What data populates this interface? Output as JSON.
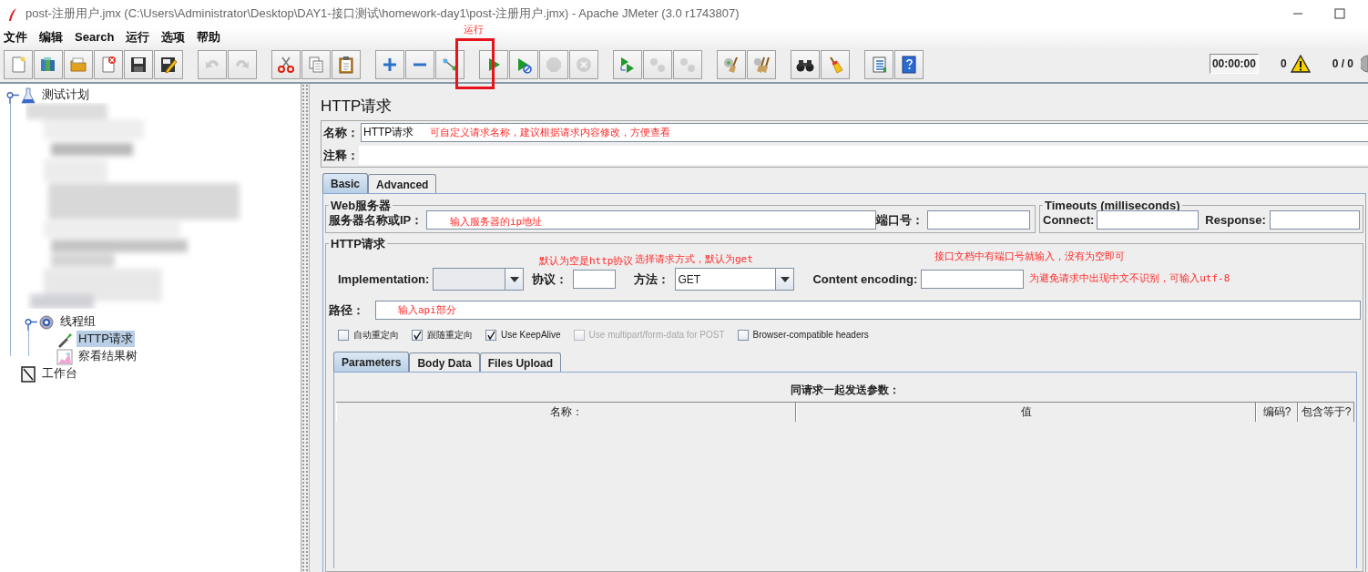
{
  "window": {
    "title": "post-注册用户.jmx (C:\\Users\\Administrator\\Desktop\\DAY1-接口测试\\homework-day1\\post-注册用户.jmx) - Apache JMeter (3.0 r1743807)"
  },
  "menu": [
    "文件",
    "编辑",
    "Search",
    "运行",
    "选项",
    "帮助"
  ],
  "toolbar": {
    "groups": [
      [
        {
          "disabled": false
        },
        {
          "disabled": false
        },
        {
          "disabled": false
        },
        {
          "disabled": false
        },
        {
          "disabled": false
        },
        {
          "disabled": false
        }
      ],
      [
        {
          "disabled": true
        },
        {
          "disabled": true
        }
      ],
      [
        {
          "disabled": false
        },
        {
          "disabled": false
        },
        {
          "disabled": false
        }
      ],
      [
        {
          "disabled": false
        },
        {
          "disabled": false
        },
        {
          "disabled": false
        }
      ],
      [
        {
          "disabled": false
        },
        {
          "disabled": false
        },
        {
          "disabled": true
        },
        {
          "disabled": true
        }
      ],
      [
        {
          "disabled": false
        },
        {
          "disabled": true
        },
        {
          "disabled": true
        }
      ],
      [
        {
          "disabled": false
        },
        {
          "disabled": false
        }
      ],
      [
        {
          "disabled": false
        },
        {
          "disabled": false
        }
      ],
      [
        {
          "disabled": false
        },
        {
          "disabled": false
        }
      ]
    ],
    "timer": "00:00:00",
    "warnings": "0",
    "threads": "0 / 0"
  },
  "tree": [
    {
      "kind": "test_plan",
      "label": "测试计划",
      "selected": false,
      "blurred_children": true,
      "children": [
        {
          "kind": "thread_group",
          "label": "线程组",
          "selected": false,
          "children": [
            {
              "kind": "sampler",
              "label": "HTTP请求",
              "selected": true
            },
            {
              "kind": "listener",
              "label": "察看结果树",
              "selected": false
            }
          ]
        }
      ]
    },
    {
      "kind": "workbench",
      "label": "工作台",
      "selected": false
    }
  ],
  "panel": {
    "title": "HTTP请求",
    "name_label": "名称：",
    "name_value": "HTTP请求",
    "comment_label": "注释：",
    "tabs": [
      {
        "label": "Basic",
        "selected": true
      },
      {
        "label": "Advanced",
        "selected": false
      }
    ],
    "web_server": {
      "legend": "Web服务器",
      "server_label": "服务器名称或IP：",
      "port_label": "端口号："
    },
    "timeouts": {
      "legend": "Timeouts (milliseconds)",
      "connect_label": "Connect:",
      "response_label": "Response:"
    },
    "http_request": {
      "legend": "HTTP请求",
      "implementation_label": "Implementation:",
      "protocol_label": "协议：",
      "method_label": "方法：",
      "method_value": "GET",
      "encoding_label": "Content encoding:",
      "path_label": "路径："
    },
    "checkboxes": [
      {
        "label": "自动重定向",
        "checked": false,
        "disabled": false
      },
      {
        "label": "跟随重定向",
        "checked": true,
        "disabled": false
      },
      {
        "label": "Use KeepAlive",
        "checked": true,
        "disabled": false
      },
      {
        "label": "Use multipart/form-data for POST",
        "checked": false,
        "disabled": true
      },
      {
        "label": "Browser-compatible headers",
        "checked": false,
        "disabled": false
      }
    ],
    "sub_tabs": [
      {
        "label": "Parameters",
        "selected": true
      },
      {
        "label": "Body Data",
        "selected": false
      },
      {
        "label": "Files Upload",
        "selected": false
      }
    ],
    "parameters": {
      "caption": "同请求一起发送参数：",
      "columns": [
        "名称：",
        "值",
        "编码?",
        "包含等于?"
      ]
    }
  },
  "annotations": [
    {
      "kind": "label",
      "text": "运行"
    },
    {
      "kind": "box"
    },
    {
      "kind": "label",
      "text": "可自定义请求名称，建议根据请求内容修改，方便查看"
    },
    {
      "kind": "label",
      "text": "输入服务器的ip地址"
    },
    {
      "kind": "label",
      "text": "接口文档中有端口号就输入，没有为空即可"
    },
    {
      "kind": "label",
      "text": "默认为空是http协议"
    },
    {
      "kind": "label",
      "text": "选择请求方式，默认为get"
    },
    {
      "kind": "label",
      "text": "为避免请求中出现中文不识别，可输入utf-8"
    },
    {
      "kind": "label",
      "text": "输入api部分"
    }
  ]
}
